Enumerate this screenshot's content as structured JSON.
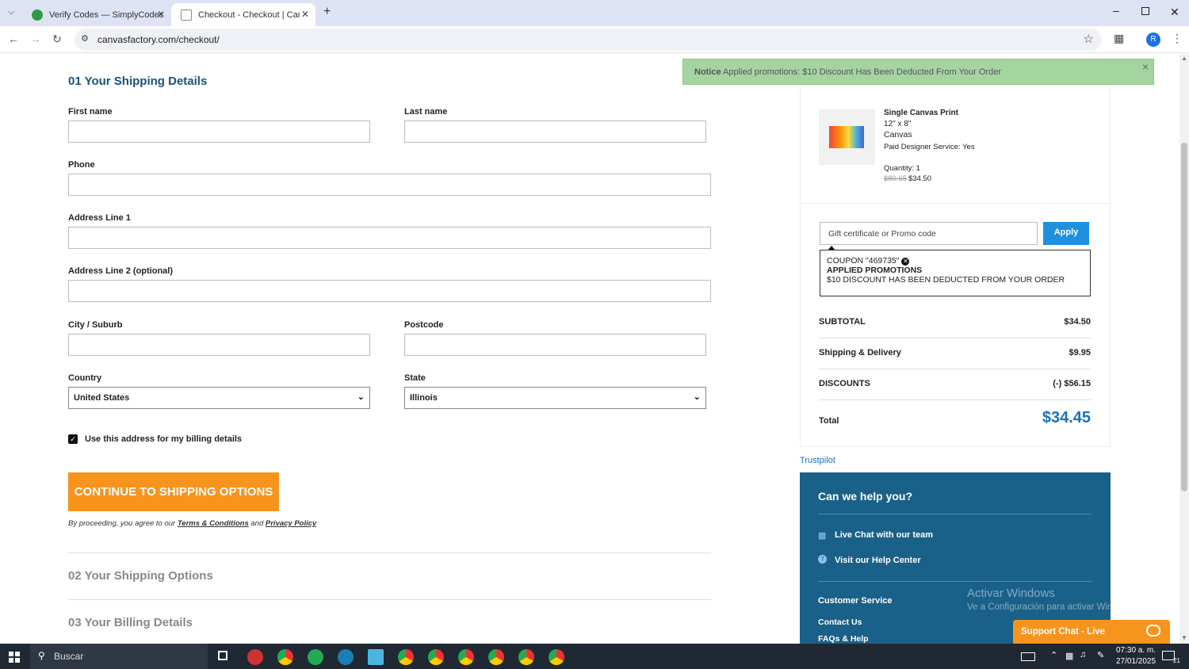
{
  "browser": {
    "tabs": [
      {
        "label": "Verify Codes — SimplyCodes"
      },
      {
        "label": "Checkout - Checkout | Canvas F"
      }
    ],
    "url": "canvasfactory.com/checkout/",
    "profile_initial": "R"
  },
  "notice": {
    "title": "Notice",
    "text": "Applied promotions: $10 Discount Has Been Deducted From Your Order",
    "close": "×"
  },
  "form": {
    "section_title": "01  Your Shipping Details",
    "first_name_label": "First name",
    "last_name_label": "Last name",
    "phone_label": "Phone",
    "address1_label": "Address Line 1",
    "address2_label": "Address Line 2 (optional)",
    "city_label": "City / Suburb",
    "postcode_label": "Postcode",
    "country_label": "Country",
    "country_value": "United States",
    "state_label": "State",
    "state_value": "Illinois",
    "billing_checkbox_label": "Use this address for my billing details",
    "continue_button": "CONTINUE TO SHIPPING OPTIONS",
    "terms_prefix": "By proceeding, you agree to our",
    "terms_link": "Terms & Conditions",
    "terms_and": "and",
    "privacy_link": "Privacy Policy",
    "section2_title": "02  Your Shipping Options",
    "section3_title": "03  Your Billing Details"
  },
  "product": {
    "name": "Single Canvas Print",
    "size": "12\" x 8\"",
    "material": "Canvas",
    "designer_service": "Paid Designer Service:  Yes",
    "quantity": "Quantity: 1",
    "old_price": "$80.65",
    "price": "$34.50"
  },
  "promo": {
    "placeholder": "Gift certificate or Promo code",
    "apply": "Apply",
    "coupon": "COUPON \"469735\"",
    "applied_title": "APPLIED PROMOTIONS",
    "applied_text": "$10 DISCOUNT HAS BEEN DEDUCTED FROM YOUR ORDER"
  },
  "summary": {
    "subtotal_label": "SUBTOTAL",
    "subtotal": "$34.50",
    "shipping_label": "Shipping & Delivery",
    "shipping": "$9.95",
    "discounts_label": "DISCOUNTS",
    "discounts": "(-) $56.15",
    "total_label": "Total",
    "total": "$34.45"
  },
  "trustpilot": "Trustpilot",
  "help": {
    "title": "Can we help you?",
    "live_chat": "Live Chat with our team",
    "help_center": "Visit our Help Center",
    "customer_service": "Customer Service",
    "contact": "Contact Us",
    "faqs": "FAQs & Help"
  },
  "watermark": {
    "title": "Activar Windows",
    "sub": "Ve a Configuración para activar Windows."
  },
  "support_chat": "Support Chat - Live",
  "taskbar": {
    "search": "Buscar",
    "time": "07:30 a. m.",
    "date": "27/01/2025",
    "notif_count": "21"
  },
  "colors": {
    "accent_orange": "#f7941d",
    "title_blue": "#1a5276",
    "total_blue": "#1a73b8",
    "help_bg": "#1a6189",
    "notice_green": "#a4d4a0"
  }
}
